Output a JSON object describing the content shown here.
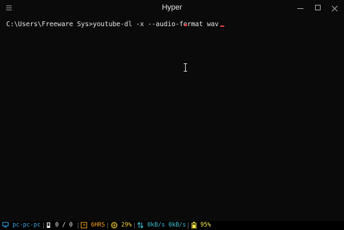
{
  "window": {
    "title": "Hyper"
  },
  "terminal": {
    "prompt": "C:\\Users\\Freeware Sys>",
    "command": "youtube-dl -x --audio-format wav"
  },
  "statusbar": {
    "hostname": "pc-pc-pc",
    "memory": "0 / 0",
    "uptime": "6HRS",
    "cpu": "29%",
    "network": "0kB/s 0kB/s",
    "battery": "95%"
  },
  "colors": {
    "hostname": "#3fa8e8",
    "uptime": "#f5a623",
    "cpu": "#f5d13a",
    "network": "#3fc2d8",
    "battery": "#f5e94a",
    "cursor": "#e23b3b"
  },
  "icons": [
    "hamburger-menu-icon",
    "minimize-icon",
    "maximize-icon",
    "close-icon",
    "computer-icon",
    "memory-icon",
    "clock-icon",
    "cpu-icon",
    "network-icon",
    "battery-icon",
    "text-cursor-icon"
  ]
}
